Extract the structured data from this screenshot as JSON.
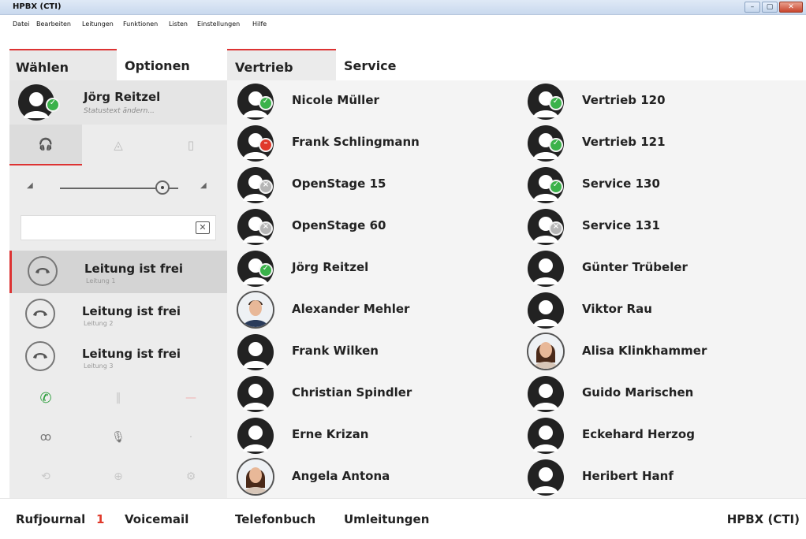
{
  "window": {
    "title": "HPBX (CTI)",
    "minimize": "–",
    "maximize": "▢",
    "close": "✕"
  },
  "menu": [
    "Datei",
    "Bearbeiten",
    "Leitungen",
    "Funktionen",
    "Listen",
    "Einstellungen",
    "Hilfe"
  ],
  "left_tabs": {
    "dial": "Wählen",
    "options": "Optionen"
  },
  "me": {
    "name": "Jörg Reitzel",
    "status_text": "Statustext ändern..."
  },
  "dial_input": {
    "value": ""
  },
  "lines": [
    {
      "title": "Leitung ist frei",
      "sub": "Leitung 1"
    },
    {
      "title": "Leitung ist frei",
      "sub": "Leitung 2"
    },
    {
      "title": "Leitung ist frei",
      "sub": "Leitung 3"
    }
  ],
  "right_tabs": {
    "sales": "Vertrieb",
    "service": "Service"
  },
  "contacts_left": [
    {
      "name": "Nicole Müller",
      "status": "avail"
    },
    {
      "name": "Frank Schlingmann",
      "status": "busy"
    },
    {
      "name": "OpenStage 15",
      "status": "off"
    },
    {
      "name": "OpenStage 60",
      "status": "off"
    },
    {
      "name": "Jörg Reitzel",
      "status": "avail"
    },
    {
      "name": "Alexander Mehler",
      "status": "photo-male"
    },
    {
      "name": "Frank Wilken",
      "status": "none"
    },
    {
      "name": "Christian Spindler",
      "status": "none"
    },
    {
      "name": "Erne Krizan",
      "status": "none"
    },
    {
      "name": "Angela Antona",
      "status": "photo-female"
    }
  ],
  "contacts_right": [
    {
      "name": "Vertrieb 120",
      "status": "avail"
    },
    {
      "name": "Vertrieb 121",
      "status": "avail"
    },
    {
      "name": "Service 130",
      "status": "avail"
    },
    {
      "name": "Service 131",
      "status": "off"
    },
    {
      "name": "Günter Trübeler",
      "status": "none"
    },
    {
      "name": "Viktor Rau",
      "status": "none"
    },
    {
      "name": "Alisa Klinkhammer",
      "status": "photo-female"
    },
    {
      "name": "Guido Marischen",
      "status": "none"
    },
    {
      "name": "Eckehard Herzog",
      "status": "none"
    },
    {
      "name": "Heribert Hanf",
      "status": "none"
    }
  ],
  "bottom": {
    "journal": "Rufjournal",
    "journal_count": "1",
    "voicemail": "Voicemail",
    "phonebook": "Telefonbuch",
    "forwarding": "Umleitungen",
    "brand": "HPBX (CTI)"
  },
  "colors": {
    "accent": "#dd3333",
    "available": "#3bb24a",
    "busy": "#e0392a",
    "offline": "#b5b5b5"
  }
}
